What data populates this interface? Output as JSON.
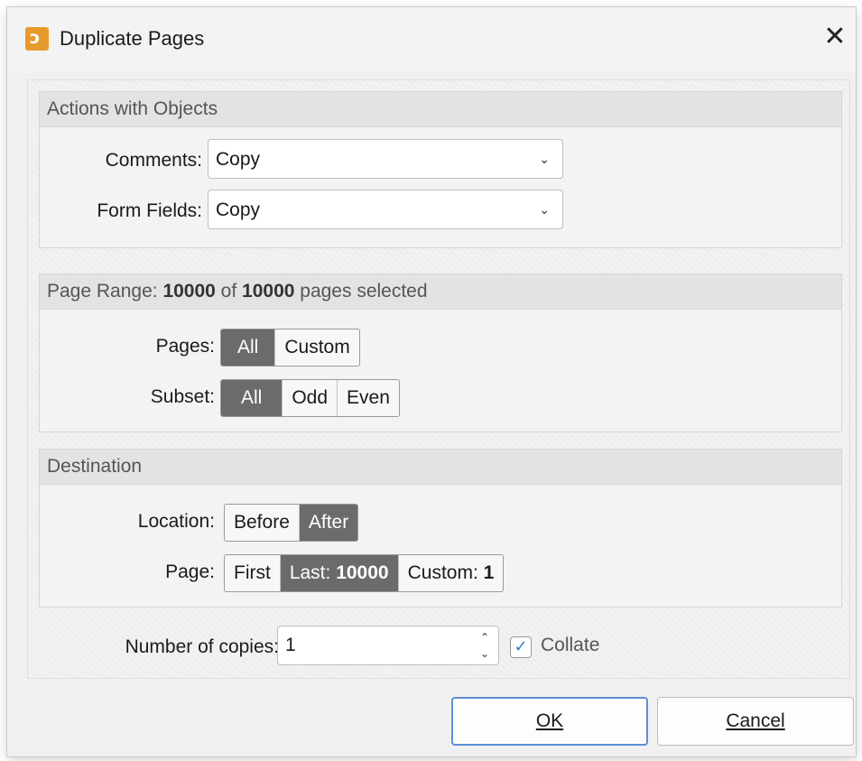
{
  "window": {
    "title": "Duplicate Pages",
    "icon": "app-logo-icon",
    "close_glyph": "✕"
  },
  "actions_group": {
    "header": "Actions with Objects",
    "comments_label": "Comments:",
    "comments_value": "Copy",
    "form_fields_label": "Form Fields:",
    "form_fields_value": "Copy"
  },
  "range_group": {
    "header_prefix": "Page Range: ",
    "selected_count": "10000",
    "header_of": " of ",
    "total_count": "10000",
    "header_suffix": " pages selected",
    "pages_label": "Pages:",
    "pages_options": [
      "All",
      "Custom"
    ],
    "pages_selected": "All",
    "subset_label": "Subset:",
    "subset_options": [
      "All",
      "Odd",
      "Even"
    ],
    "subset_selected": "All"
  },
  "destination_group": {
    "header": "Destination",
    "location_label": "Location:",
    "location_options": [
      "Before",
      "After"
    ],
    "location_selected": "After",
    "page_label": "Page:",
    "page_first": "First",
    "page_last_label": "Last:",
    "page_last_value": "10000",
    "page_custom_label": "Custom:",
    "page_custom_value": "1",
    "page_selected": "Last"
  },
  "copies": {
    "label": "Number of copies:",
    "value": "1",
    "collate_label": "Collate",
    "collate_checked": true
  },
  "buttons": {
    "ok": "OK",
    "cancel": "Cancel"
  },
  "colors": {
    "accent_selected": "#6b6b6b",
    "focus_border": "#5b8fd6",
    "checkbox_tick": "#3b79c7",
    "app_icon": "#e79a2c"
  }
}
